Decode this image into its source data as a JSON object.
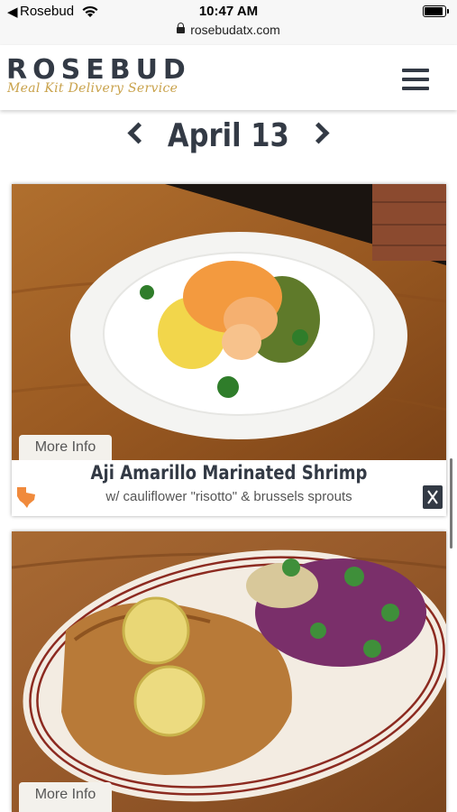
{
  "status_bar": {
    "back_app": "Rosebud",
    "time": "10:47 AM",
    "url": "rosebudatx.com"
  },
  "header": {
    "logo_name": "ROSEBUD",
    "logo_tagline": "Meal Kit Delivery Service"
  },
  "date_nav": {
    "date": "April 13"
  },
  "meals": [
    {
      "title": "Aji Amarillo Marinated Shrimp",
      "subtitle": "w/ cauliflower \"risotto\" & brussels sprouts",
      "more_info": "More Info"
    },
    {
      "more_info": "More Info"
    }
  ],
  "colors": {
    "brand_dark": "#333a45",
    "brand_gold": "#c9a24b",
    "badge_orange": "#f08a3c"
  }
}
